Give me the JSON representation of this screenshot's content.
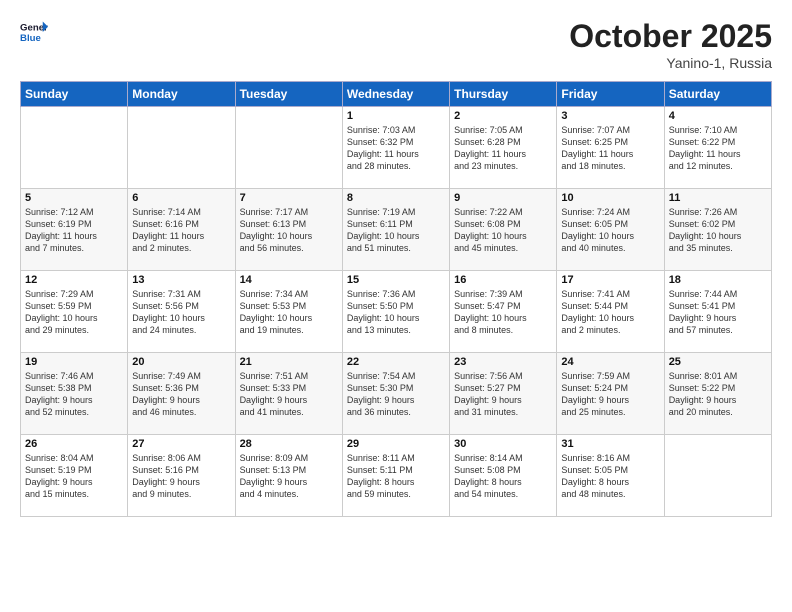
{
  "header": {
    "logo_general": "General",
    "logo_blue": "Blue",
    "month": "October 2025",
    "location": "Yanino-1, Russia"
  },
  "weekdays": [
    "Sunday",
    "Monday",
    "Tuesday",
    "Wednesday",
    "Thursday",
    "Friday",
    "Saturday"
  ],
  "weeks": [
    [
      {
        "day": "",
        "info": ""
      },
      {
        "day": "",
        "info": ""
      },
      {
        "day": "",
        "info": ""
      },
      {
        "day": "1",
        "info": "Sunrise: 7:03 AM\nSunset: 6:32 PM\nDaylight: 11 hours\nand 28 minutes."
      },
      {
        "day": "2",
        "info": "Sunrise: 7:05 AM\nSunset: 6:28 PM\nDaylight: 11 hours\nand 23 minutes."
      },
      {
        "day": "3",
        "info": "Sunrise: 7:07 AM\nSunset: 6:25 PM\nDaylight: 11 hours\nand 18 minutes."
      },
      {
        "day": "4",
        "info": "Sunrise: 7:10 AM\nSunset: 6:22 PM\nDaylight: 11 hours\nand 12 minutes."
      }
    ],
    [
      {
        "day": "5",
        "info": "Sunrise: 7:12 AM\nSunset: 6:19 PM\nDaylight: 11 hours\nand 7 minutes."
      },
      {
        "day": "6",
        "info": "Sunrise: 7:14 AM\nSunset: 6:16 PM\nDaylight: 11 hours\nand 2 minutes."
      },
      {
        "day": "7",
        "info": "Sunrise: 7:17 AM\nSunset: 6:13 PM\nDaylight: 10 hours\nand 56 minutes."
      },
      {
        "day": "8",
        "info": "Sunrise: 7:19 AM\nSunset: 6:11 PM\nDaylight: 10 hours\nand 51 minutes."
      },
      {
        "day": "9",
        "info": "Sunrise: 7:22 AM\nSunset: 6:08 PM\nDaylight: 10 hours\nand 45 minutes."
      },
      {
        "day": "10",
        "info": "Sunrise: 7:24 AM\nSunset: 6:05 PM\nDaylight: 10 hours\nand 40 minutes."
      },
      {
        "day": "11",
        "info": "Sunrise: 7:26 AM\nSunset: 6:02 PM\nDaylight: 10 hours\nand 35 minutes."
      }
    ],
    [
      {
        "day": "12",
        "info": "Sunrise: 7:29 AM\nSunset: 5:59 PM\nDaylight: 10 hours\nand 29 minutes."
      },
      {
        "day": "13",
        "info": "Sunrise: 7:31 AM\nSunset: 5:56 PM\nDaylight: 10 hours\nand 24 minutes."
      },
      {
        "day": "14",
        "info": "Sunrise: 7:34 AM\nSunset: 5:53 PM\nDaylight: 10 hours\nand 19 minutes."
      },
      {
        "day": "15",
        "info": "Sunrise: 7:36 AM\nSunset: 5:50 PM\nDaylight: 10 hours\nand 13 minutes."
      },
      {
        "day": "16",
        "info": "Sunrise: 7:39 AM\nSunset: 5:47 PM\nDaylight: 10 hours\nand 8 minutes."
      },
      {
        "day": "17",
        "info": "Sunrise: 7:41 AM\nSunset: 5:44 PM\nDaylight: 10 hours\nand 2 minutes."
      },
      {
        "day": "18",
        "info": "Sunrise: 7:44 AM\nSunset: 5:41 PM\nDaylight: 9 hours\nand 57 minutes."
      }
    ],
    [
      {
        "day": "19",
        "info": "Sunrise: 7:46 AM\nSunset: 5:38 PM\nDaylight: 9 hours\nand 52 minutes."
      },
      {
        "day": "20",
        "info": "Sunrise: 7:49 AM\nSunset: 5:36 PM\nDaylight: 9 hours\nand 46 minutes."
      },
      {
        "day": "21",
        "info": "Sunrise: 7:51 AM\nSunset: 5:33 PM\nDaylight: 9 hours\nand 41 minutes."
      },
      {
        "day": "22",
        "info": "Sunrise: 7:54 AM\nSunset: 5:30 PM\nDaylight: 9 hours\nand 36 minutes."
      },
      {
        "day": "23",
        "info": "Sunrise: 7:56 AM\nSunset: 5:27 PM\nDaylight: 9 hours\nand 31 minutes."
      },
      {
        "day": "24",
        "info": "Sunrise: 7:59 AM\nSunset: 5:24 PM\nDaylight: 9 hours\nand 25 minutes."
      },
      {
        "day": "25",
        "info": "Sunrise: 8:01 AM\nSunset: 5:22 PM\nDaylight: 9 hours\nand 20 minutes."
      }
    ],
    [
      {
        "day": "26",
        "info": "Sunrise: 8:04 AM\nSunset: 5:19 PM\nDaylight: 9 hours\nand 15 minutes."
      },
      {
        "day": "27",
        "info": "Sunrise: 8:06 AM\nSunset: 5:16 PM\nDaylight: 9 hours\nand 9 minutes."
      },
      {
        "day": "28",
        "info": "Sunrise: 8:09 AM\nSunset: 5:13 PM\nDaylight: 9 hours\nand 4 minutes."
      },
      {
        "day": "29",
        "info": "Sunrise: 8:11 AM\nSunset: 5:11 PM\nDaylight: 8 hours\nand 59 minutes."
      },
      {
        "day": "30",
        "info": "Sunrise: 8:14 AM\nSunset: 5:08 PM\nDaylight: 8 hours\nand 54 minutes."
      },
      {
        "day": "31",
        "info": "Sunrise: 8:16 AM\nSunset: 5:05 PM\nDaylight: 8 hours\nand 48 minutes."
      },
      {
        "day": "",
        "info": ""
      }
    ]
  ]
}
